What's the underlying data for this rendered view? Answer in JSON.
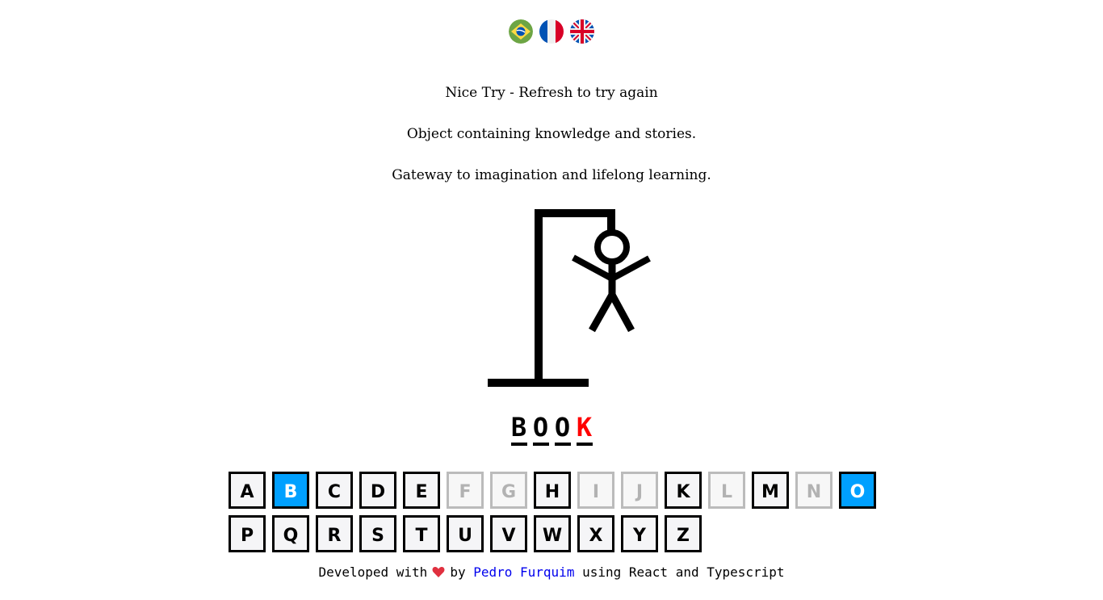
{
  "languages": [
    {
      "code": "pt-BR",
      "icon": "brazil-flag-icon"
    },
    {
      "code": "fr",
      "icon": "france-flag-icon"
    },
    {
      "code": "en",
      "icon": "uk-flag-icon"
    }
  ],
  "status": "Nice Try - Refresh to try again",
  "hints": [
    "Object containing knowledge and stories.",
    "Gateway to imagination and lifelong learning."
  ],
  "word": [
    {
      "letter": "B",
      "state": "guessed"
    },
    {
      "letter": "O",
      "state": "guessed"
    },
    {
      "letter": "O",
      "state": "guessed"
    },
    {
      "letter": "K",
      "state": "missed"
    }
  ],
  "colors": {
    "active": "#00a0ff",
    "missed": "#ff0000",
    "link": "#0000ee",
    "heart": "#e0303f"
  },
  "keyboard": [
    {
      "letter": "A",
      "state": "available"
    },
    {
      "letter": "B",
      "state": "active"
    },
    {
      "letter": "C",
      "state": "available"
    },
    {
      "letter": "D",
      "state": "available"
    },
    {
      "letter": "E",
      "state": "available"
    },
    {
      "letter": "F",
      "state": "inactive"
    },
    {
      "letter": "G",
      "state": "inactive"
    },
    {
      "letter": "H",
      "state": "available"
    },
    {
      "letter": "I",
      "state": "inactive"
    },
    {
      "letter": "J",
      "state": "inactive"
    },
    {
      "letter": "K",
      "state": "available"
    },
    {
      "letter": "L",
      "state": "inactive"
    },
    {
      "letter": "M",
      "state": "available"
    },
    {
      "letter": "N",
      "state": "inactive"
    },
    {
      "letter": "O",
      "state": "active"
    },
    {
      "letter": "P",
      "state": "available"
    },
    {
      "letter": "Q",
      "state": "available"
    },
    {
      "letter": "R",
      "state": "available"
    },
    {
      "letter": "S",
      "state": "available"
    },
    {
      "letter": "T",
      "state": "available"
    },
    {
      "letter": "U",
      "state": "available"
    },
    {
      "letter": "V",
      "state": "available"
    },
    {
      "letter": "W",
      "state": "available"
    },
    {
      "letter": "X",
      "state": "available"
    },
    {
      "letter": "Y",
      "state": "available"
    },
    {
      "letter": "Z",
      "state": "available"
    }
  ],
  "footer": {
    "prefix": "Developed with",
    "heart_icon": "heart-icon",
    "by": "by",
    "author": "Pedro Furquim",
    "suffix": "using React and Typescript"
  }
}
